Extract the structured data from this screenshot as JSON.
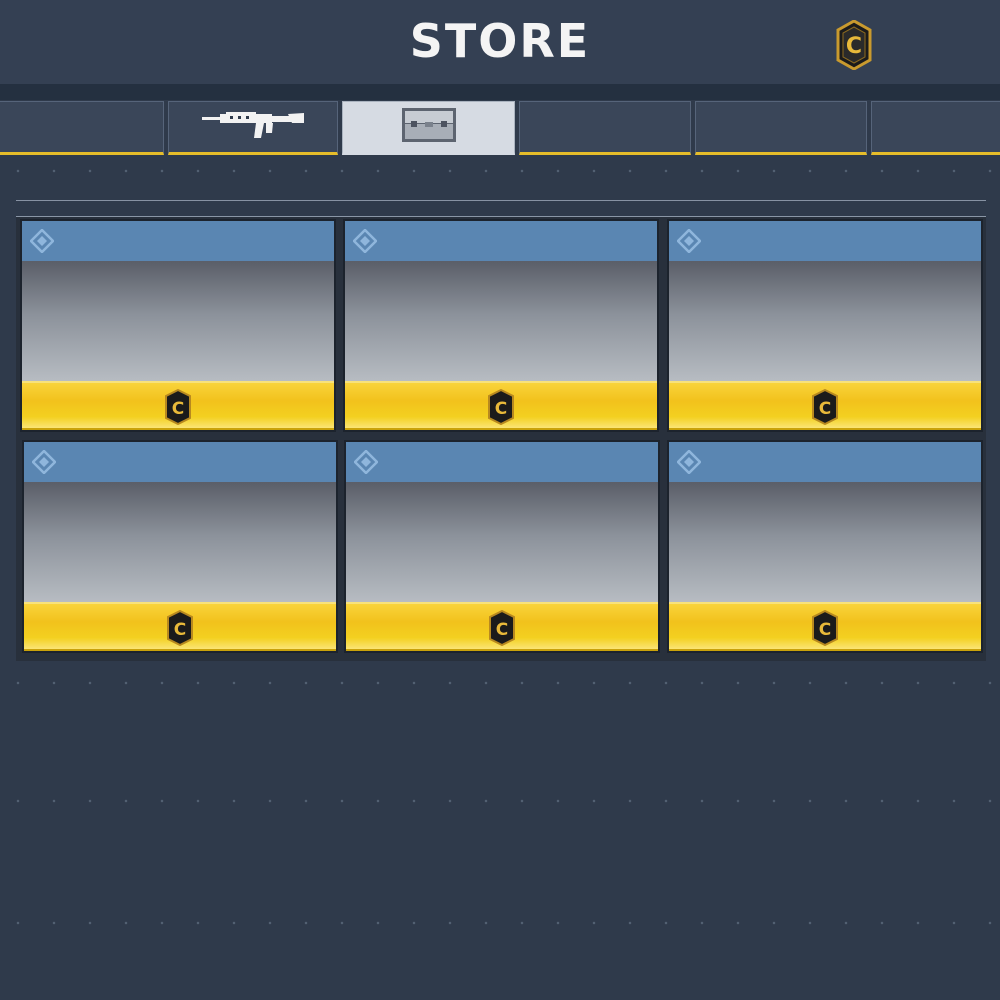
{
  "header": {
    "title": "STORE",
    "currency_icon": "cod-points-coin-icon"
  },
  "tabs": [
    {
      "name": "tab-1",
      "icon": "",
      "active": false
    },
    {
      "name": "tab-weapons",
      "icon": "assault-rifle-icon",
      "active": false
    },
    {
      "name": "tab-crates",
      "icon": "crate-icon",
      "active": true
    },
    {
      "name": "tab-4",
      "icon": "",
      "active": false
    },
    {
      "name": "tab-5",
      "icon": "",
      "active": false
    },
    {
      "name": "tab-6",
      "icon": "",
      "active": false
    }
  ],
  "store_items": [
    {
      "badge_icon": "diamond-badge-icon",
      "price_icon": "cod-points-coin-icon"
    },
    {
      "badge_icon": "diamond-badge-icon",
      "price_icon": "cod-points-coin-icon"
    },
    {
      "badge_icon": "diamond-badge-icon",
      "price_icon": "cod-points-coin-icon"
    },
    {
      "badge_icon": "diamond-badge-icon",
      "price_icon": "cod-points-coin-icon"
    },
    {
      "badge_icon": "diamond-badge-icon",
      "price_icon": "cod-points-coin-icon"
    },
    {
      "badge_icon": "diamond-badge-icon",
      "price_icon": "cod-points-coin-icon"
    }
  ],
  "colors": {
    "background": "#2f3a4b",
    "accent_gold": "#f2c21c",
    "card_header": "#5a86b2"
  }
}
